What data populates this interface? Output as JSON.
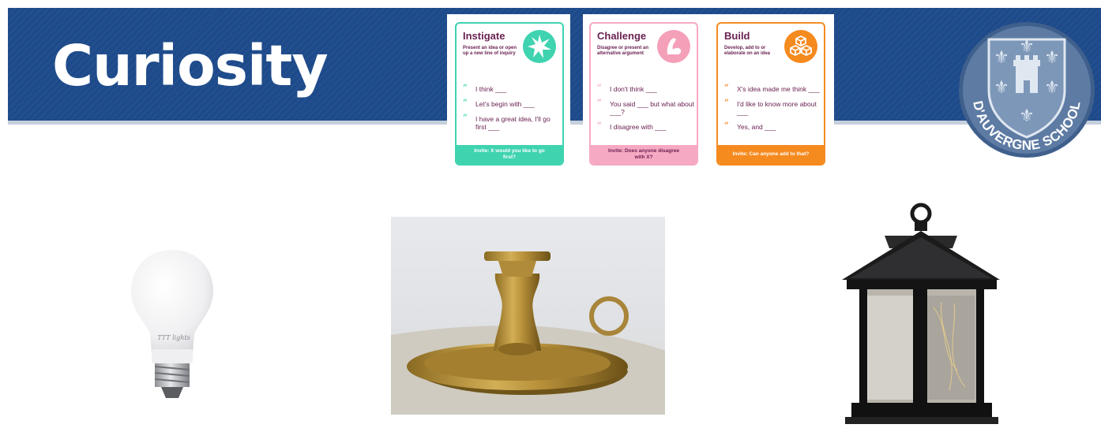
{
  "slide": {
    "title": "Curiosity",
    "colors": {
      "banner": "#1d4a8a",
      "instigate": "#3fd3b0",
      "challenge": "#f6a9c2",
      "build": "#f58a1f",
      "text_purple": "#6b2252"
    }
  },
  "cards": {
    "instigate": {
      "title": "Instigate",
      "subtitle": "Present an idea or open up a new line of inquiry",
      "icon": "starburst-icon",
      "phrases": [
        "I think ___",
        "Let's begin with ___",
        "I have a great idea, I'll go first ___"
      ],
      "footer": "Invite: X would you like to go first?"
    },
    "challenge": {
      "title": "Challenge",
      "subtitle": "Disagree or present an alternative argument",
      "icon": "flexed-arm-icon",
      "phrases": [
        "I don't think ___",
        "You said ___ but what about ___?",
        "I disagree with ___"
      ],
      "footer": "Invite: Does anyone disagree with X?"
    },
    "build": {
      "title": "Build",
      "subtitle": "Develop, add to or elaborate on an idea",
      "icon": "stacked-cubes-icon",
      "phrases": [
        "X's idea made me think ___",
        "I'd like to know more about ___",
        "Yes, and ___"
      ],
      "footer": "Invite: Can anyone add to that?"
    }
  },
  "crest": {
    "text": "D'AUVERGNE SCHOOL"
  },
  "images": {
    "bulb": {
      "brand": "TTT lights"
    }
  }
}
